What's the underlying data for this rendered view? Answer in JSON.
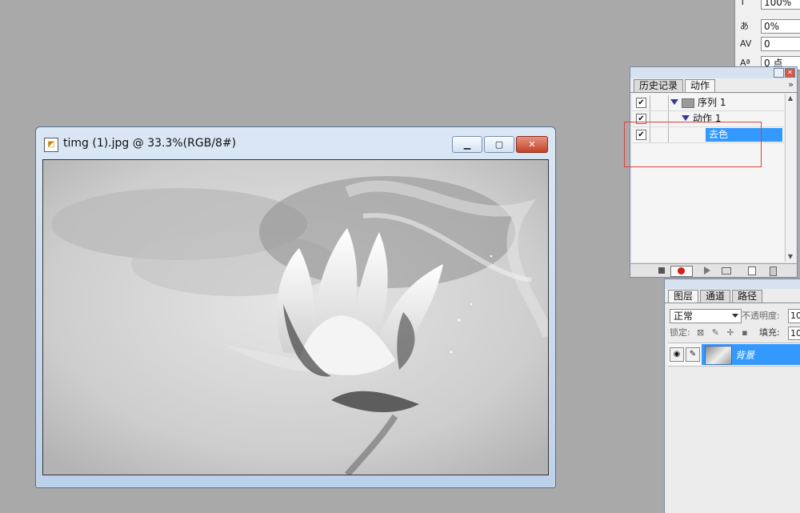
{
  "character_panel": {
    "size_value": "100%",
    "tracking_value": "0%",
    "kerning_value": "0",
    "baseline_value": "0 点",
    "size_glyph": "T",
    "tracking_glyph": "あ",
    "kerning_glyph": "AV",
    "baseline_glyph": "Aª"
  },
  "actions_palette": {
    "tab_history": "历史记录",
    "tab_actions": "动作",
    "more_glyph": "»",
    "rows": [
      {
        "label": "序列 1",
        "check": "✔"
      },
      {
        "label": "动作 1",
        "check": "✔"
      },
      {
        "label": "去色",
        "check": "✔"
      }
    ],
    "highlight_color": "#e04040",
    "selection_color": "#3399ff"
  },
  "layers_palette": {
    "tab_layers": "图层",
    "tab_channels": "通道",
    "tab_paths": "路径",
    "blend_mode": "正常",
    "opacity_label": "不透明度:",
    "opacity_value": "10",
    "lock_label": "锁定:",
    "lock_icons": "⊠ ✎ ✛ ▪",
    "fill_label": "填充:",
    "fill_value": "10",
    "layer_name": "背景",
    "eye_glyph": "◉",
    "brush_glyph": "✎"
  },
  "document_window": {
    "title": "timg (1).jpg @ 33.3%(RGB/8#)",
    "minimize_glyph": "▁",
    "maximize_glyph": "▢",
    "close_glyph": "✕",
    "image_description": "lotus"
  }
}
